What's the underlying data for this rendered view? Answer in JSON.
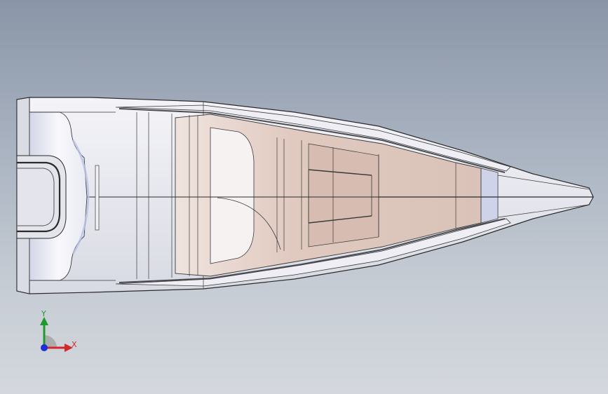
{
  "viewport": {
    "background_top": "#8a95a7",
    "background_bottom": "#d4d8de"
  },
  "model": {
    "type": "boat-hull",
    "view": "top",
    "hull_color": "#e9eaf0",
    "deck_color": "#f6f6fa",
    "cockpit_color": "#dcc4ba",
    "edge_color": "#2a2a2a",
    "highlight_color": "#c9cfe6"
  },
  "triad": {
    "y_label": "Y",
    "x_label": "X",
    "y_color": "#1f9a2e",
    "x_color": "#d22a2a",
    "z_color": "#1d2fd6"
  }
}
